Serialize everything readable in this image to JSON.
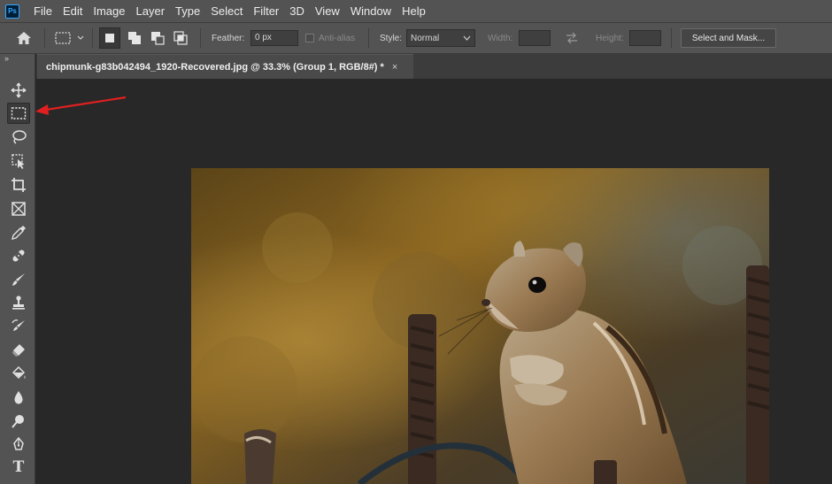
{
  "app": {
    "logo_text": "Ps"
  },
  "menu": {
    "items": [
      "File",
      "Edit",
      "Image",
      "Layer",
      "Type",
      "Select",
      "Filter",
      "3D",
      "View",
      "Window",
      "Help"
    ]
  },
  "options": {
    "feather_label": "Feather:",
    "feather_value": "0 px",
    "antialias_label": "Anti-alias",
    "style_label": "Style:",
    "style_value": "Normal",
    "width_label": "Width:",
    "height_label": "Height:",
    "select_mask_label": "Select and Mask..."
  },
  "toolbar": {
    "collapse": "»",
    "type_tool_glyph": "T",
    "tools": [
      "move-tool",
      "rectangular-marquee-tool",
      "lasso-tool",
      "object-selection-tool",
      "crop-tool",
      "frame-tool",
      "eyedropper-tool",
      "spot-healing-brush-tool",
      "brush-tool",
      "clone-stamp-tool",
      "history-brush-tool",
      "eraser-tool",
      "paint-bucket-tool",
      "blur-tool",
      "dodge-tool",
      "pen-tool",
      "type-tool"
    ],
    "active_tool": "rectangular-marquee-tool"
  },
  "document": {
    "tab_title": "chipmunk-g83b042494_1920-Recovered.jpg @ 33.3% (Group 1, RGB/8#) *",
    "close_glyph": "×"
  },
  "colors": {
    "annotation_arrow": "#e02020",
    "panel": "#535353",
    "canvas": "#282828"
  }
}
